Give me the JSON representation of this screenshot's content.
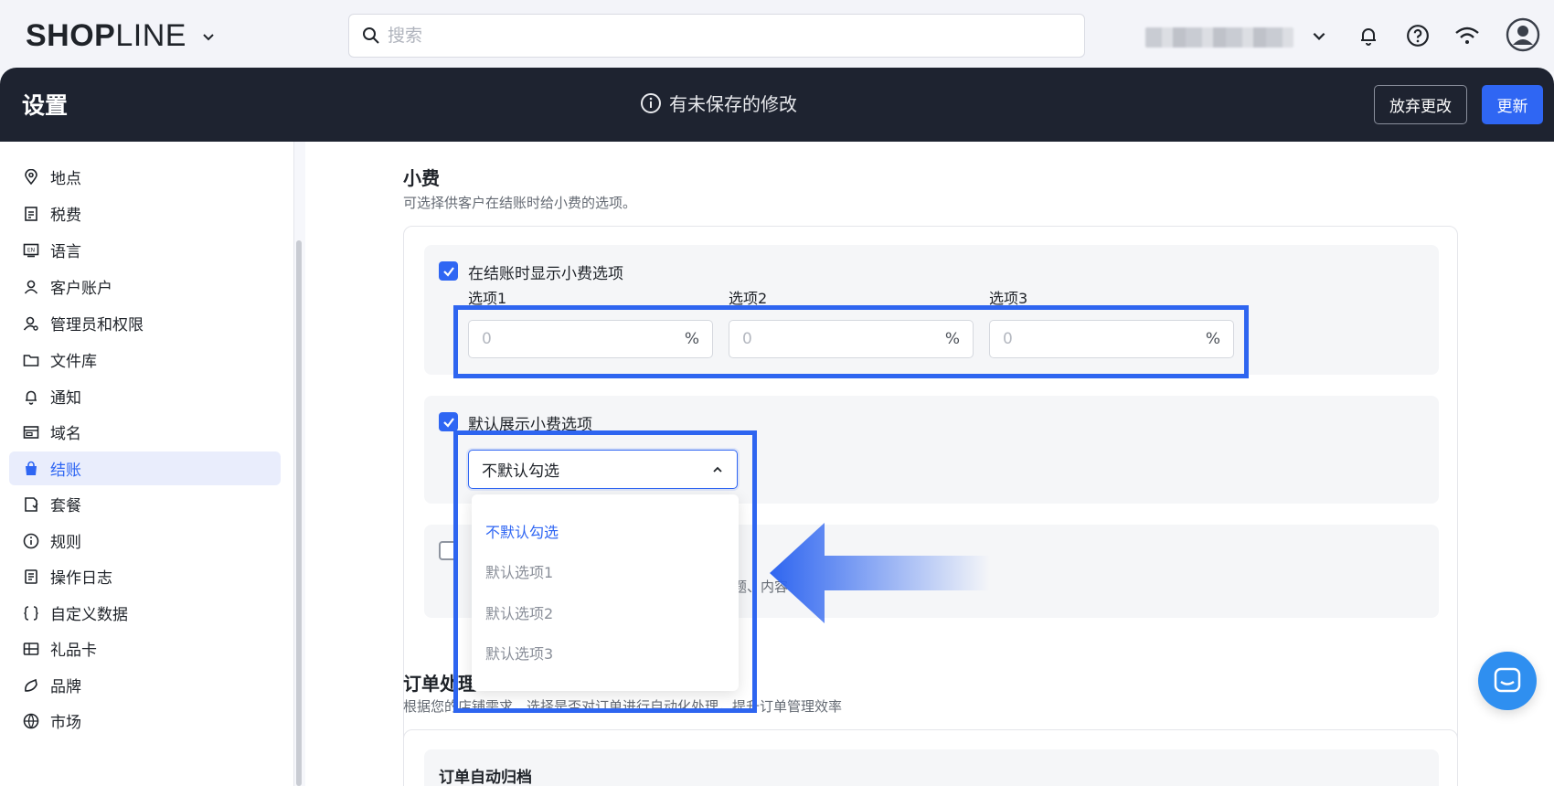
{
  "header": {
    "logo_bold": "SHOP",
    "logo_light": "LINE",
    "search_placeholder": "搜索"
  },
  "settings_bar": {
    "title": "设置",
    "unsaved_notice": "有未保存的修改",
    "discard_label": "放弃更改",
    "update_label": "更新"
  },
  "sidebar": {
    "items": [
      {
        "label": "地点",
        "icon": "location-pin-icon"
      },
      {
        "label": "税费",
        "icon": "tax-icon"
      },
      {
        "label": "语言",
        "icon": "language-icon"
      },
      {
        "label": "客户账户",
        "icon": "user-icon"
      },
      {
        "label": "管理员和权限",
        "icon": "admin-icon"
      },
      {
        "label": "文件库",
        "icon": "folder-icon"
      },
      {
        "label": "通知",
        "icon": "bell-icon"
      },
      {
        "label": "域名",
        "icon": "domain-icon"
      },
      {
        "label": "结账",
        "icon": "shopping-bag-icon",
        "active": true
      },
      {
        "label": "套餐",
        "icon": "plan-icon"
      },
      {
        "label": "规则",
        "icon": "info-icon"
      },
      {
        "label": "操作日志",
        "icon": "log-icon"
      },
      {
        "label": "自定义数据",
        "icon": "custom-data-icon"
      },
      {
        "label": "礼品卡",
        "icon": "gift-card-icon"
      },
      {
        "label": "品牌",
        "icon": "brand-icon"
      },
      {
        "label": "市场",
        "icon": "globe-icon"
      }
    ]
  },
  "tips": {
    "title": "小费",
    "description": "可选择供客户在结账时给小费的选项。",
    "show_tips_label": "在结账时显示小费选项",
    "options": [
      {
        "label": "选项1",
        "value": "0",
        "unit": "%"
      },
      {
        "label": "选项2",
        "value": "0",
        "unit": "%"
      },
      {
        "label": "选项3",
        "value": "0",
        "unit": "%"
      }
    ],
    "default_display_label": "默认展示小费选项",
    "default_select_value": "不默认勾选",
    "dropdown_options": [
      "不默认勾选",
      "默认选项1",
      "默认选项2",
      "默认选项3"
    ],
    "hidden_text_fragment": "题、内容"
  },
  "orders": {
    "title_fragment": "订单处理",
    "description": "根据您的店铺需求，选择是否对订单进行自动化处理，提升订单管理效率",
    "auto_archive_label": "订单自动归档"
  }
}
